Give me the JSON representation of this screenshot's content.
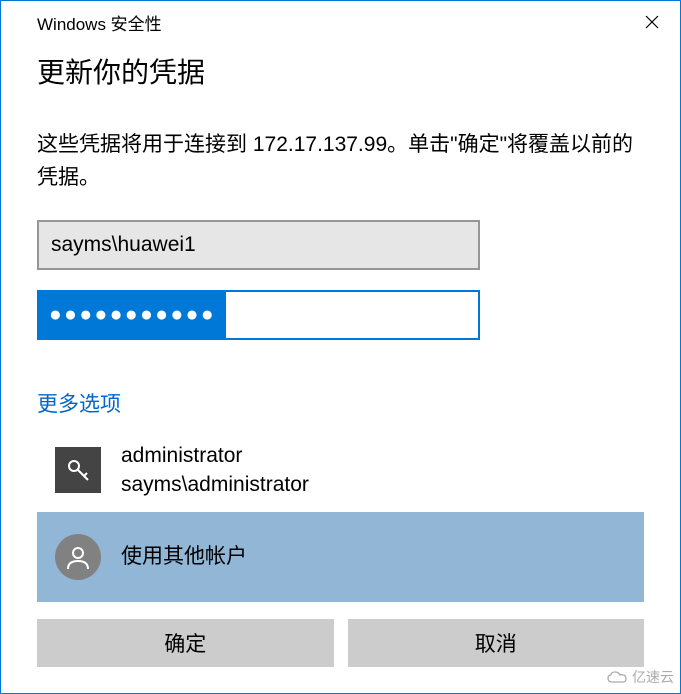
{
  "titlebar": {
    "title": "Windows 安全性"
  },
  "heading": "更新你的凭据",
  "description": "这些凭据将用于连接到 172.17.137.99。单击\"确定\"将覆盖以前的凭据。",
  "username_value": "sayms\\huawei1",
  "password_mask": "●●●●●●●●●●●",
  "more_options_label": "更多选项",
  "accounts": [
    {
      "line1": "administrator",
      "line2": "sayms\\administrator"
    },
    {
      "line1": "使用其他帐户"
    }
  ],
  "buttons": {
    "ok": "确定",
    "cancel": "取消"
  },
  "watermark": "亿速云"
}
